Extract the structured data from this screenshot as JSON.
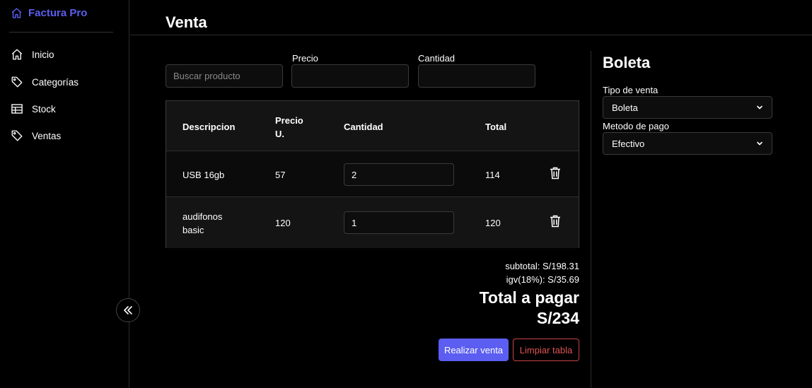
{
  "app": {
    "name": "Factura Pro"
  },
  "sidebar": {
    "items": [
      {
        "label": "Inicio",
        "icon": "home-icon"
      },
      {
        "label": "Categorías",
        "icon": "tag-icon"
      },
      {
        "label": "Stock",
        "icon": "table-icon"
      },
      {
        "label": "Ventas",
        "icon": "tag-icon"
      }
    ],
    "collapse_icon": "double-chevron-left-icon"
  },
  "header": {
    "title": "Venta"
  },
  "form": {
    "search_placeholder": "Buscar producto",
    "price_label": "Precio",
    "price_value": "",
    "quantity_label": "Cantidad",
    "quantity_value": ""
  },
  "table": {
    "columns": [
      "Descripcion",
      "Precio U.",
      "Cantidad",
      "Total"
    ],
    "rows": [
      {
        "descripcion": "USB 16gb",
        "precio": "57",
        "cantidad": "2",
        "total": "114"
      },
      {
        "descripcion": "audifonos basic",
        "precio": "120",
        "cantidad": "1",
        "total": "120"
      }
    ]
  },
  "summary": {
    "subtotal": "subtotal: S/198.31",
    "igv": "igv(18%): S/35.69",
    "total_label": "Total a pagar",
    "total_value": "S/234"
  },
  "actions": {
    "submit": "Realizar venta",
    "clear": "Limpiar tabla"
  },
  "boleta": {
    "title": "Boleta",
    "sale_type_label": "Tipo de venta",
    "sale_type_value": "Boleta",
    "payment_label": "Metodo de pago",
    "payment_value": "Efectivo"
  },
  "colors": {
    "accent": "#5b5ef0",
    "danger": "#e05555",
    "background": "#000000"
  }
}
